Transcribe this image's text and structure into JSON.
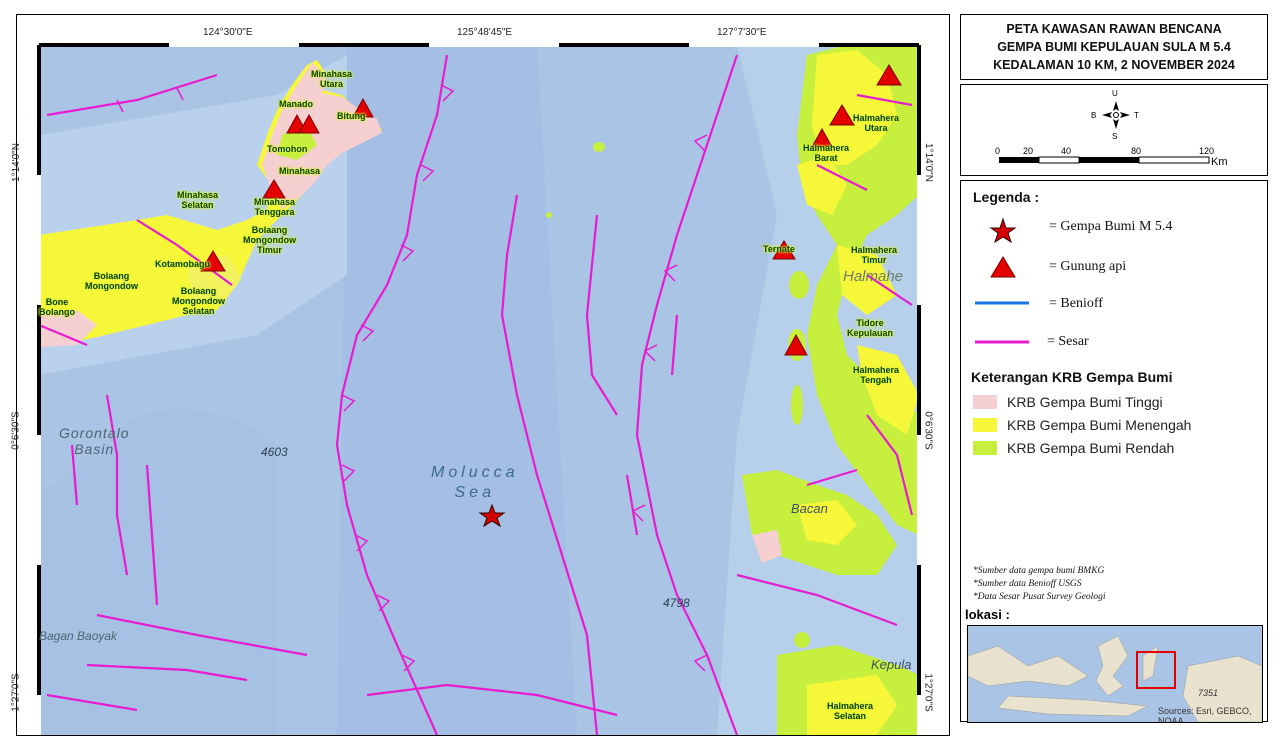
{
  "title_lines": [
    "PETA KAWASAN RAWAN BENCANA",
    "GEMPA BUMI KEPULAUAN SULA M 5.4",
    "KEDALAMAN 10 KM, 2 NOVEMBER 2024"
  ],
  "compass": {
    "north": "U",
    "south": "S",
    "west": "B",
    "east": "T"
  },
  "scale_bar": {
    "ticks": [
      "0",
      "20",
      "40",
      "80",
      "120"
    ],
    "unit": "Km"
  },
  "coordinates": {
    "top": [
      "124°30'0\"E",
      "125°48'45\"E",
      "127°7'30\"E"
    ],
    "left": [
      "1°14'0\"N",
      "0°6'30\"S",
      "1°27'0\"S"
    ],
    "right": [
      "1°14'0\"N",
      "0°6'30\"S",
      "1°27'0\"S"
    ]
  },
  "legend": {
    "title": "Legenda :",
    "items": [
      {
        "symbol": "red-star",
        "label": "= Gempa Bumi M 5.4"
      },
      {
        "symbol": "red-triangle",
        "label": "= Gunung api"
      },
      {
        "symbol": "blue-line",
        "label": "= Benioff"
      },
      {
        "symbol": "magenta-line",
        "label": "= Sesar"
      }
    ]
  },
  "krb": {
    "title": "Keterangan KRB Gempa Bumi",
    "items": [
      {
        "label": "KRB Gempa Bumi Tinggi",
        "color": "#f6cfd0"
      },
      {
        "label": "KRB Gempa Bumi  Menengah",
        "color": "#f7f73a"
      },
      {
        "label": "KRB Gempa Bumi Rendah",
        "color": "#c7ef3e"
      }
    ]
  },
  "notes": [
    "*Sumber data gempa bumi BMKG",
    "*Sumber data Benioff USGS",
    "*Data Sesar Pusat Survey Geologi"
  ],
  "location": {
    "title": "lokasi :",
    "credit": "Sources: Esri, GEBCO, NOAA",
    "number": "7351"
  },
  "map_labels": {
    "places": {
      "minahasa_utara": "Minahasa\nUtara",
      "manado": "Manado",
      "bitung": "Bitung",
      "tomohon": "Tomohon",
      "minahasa": "Minahasa",
      "minahasa_selatan": "Minahasa\nSelatan",
      "minahasa_tenggara": "Minahasa\nTenggara",
      "bolaang_mongondow_timur": "Bolaang\nMongondow\nTimur",
      "kotamobagu": "Kotamobagu",
      "bolaang_mongondow": "Bolaang\nMongondow",
      "bolaang_mongondow_selatan": "Bolaang\nMongondow\nSelatan",
      "bone_bolango": "Bone\nBolango",
      "halmahera_utara": "Halmahera\nUtara",
      "halmahera_barat": "Halmahera\nBarat",
      "ternate": "Ternate",
      "halmahera_timur": "Halmahera\nTimur",
      "tidore_kepulauan": "Tidore\nKepulauan",
      "halmahera_tengah": "Halmahera\nTengah",
      "halmahera_selatan": "Halmahera\nSelatan"
    },
    "seas": {
      "molucca": "Molucca\nSea",
      "gorontalo": "Gorontalo\nBasin",
      "bacan": "Bacan",
      "halmahera": "Halmahe",
      "kepula": "Kepula",
      "bayak": "Bagan Baoyak"
    },
    "depths": [
      "4603",
      "4798"
    ]
  },
  "colors": {
    "sea": "#a9c4e4",
    "deep_sea": "#9cb7dc",
    "krb_high": "#f6cfd0",
    "krb_mid": "#f7f73a",
    "krb_low": "#c7ef3e",
    "fault": "#e81bd0",
    "volcano": "#e50000",
    "epicenter": "#d50000"
  }
}
